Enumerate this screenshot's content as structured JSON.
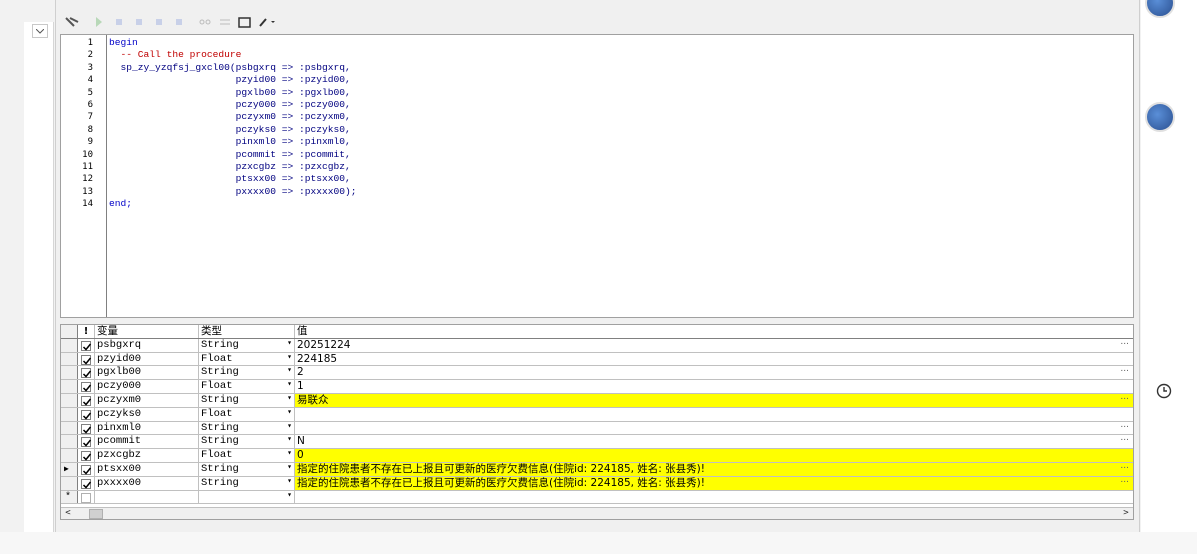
{
  "editor": {
    "line_numbers": [
      "1",
      "2",
      "3",
      "4",
      "5",
      "6",
      "7",
      "8",
      "9",
      "10",
      "11",
      "12",
      "13",
      "14"
    ],
    "lines": [
      {
        "text": "begin",
        "style": "kw"
      },
      {
        "text": "  -- Call the procedure",
        "style": "cm"
      },
      {
        "text": "  sp_zy_yzqfsj_gxcl00(psbgxrq => :psbgxrq,",
        "style": "tx"
      },
      {
        "text": "                      pzyid00 => :pzyid00,",
        "style": "tx"
      },
      {
        "text": "                      pgxlb00 => :pgxlb00,",
        "style": "tx"
      },
      {
        "text": "                      pczy000 => :pczy000,",
        "style": "tx"
      },
      {
        "text": "                      pczyxm0 => :pczyxm0,",
        "style": "tx"
      },
      {
        "text": "                      pczyks0 => :pczyks0,",
        "style": "tx"
      },
      {
        "text": "                      pinxml0 => :pinxml0,",
        "style": "tx"
      },
      {
        "text": "                      pcommit => :pcommit,",
        "style": "tx"
      },
      {
        "text": "                      pzxcgbz => :pzxcgbz,",
        "style": "tx"
      },
      {
        "text": "                      ptsxx00 => :ptsxx00,",
        "style": "tx"
      },
      {
        "text": "                      pxxxx00 => :pxxxx00);",
        "style": "tx"
      },
      {
        "text": "end;",
        "style": "kw"
      }
    ]
  },
  "grid": {
    "headers": {
      "indicator": "!",
      "name": "变量",
      "type": "类型",
      "value": "值"
    },
    "rows": [
      {
        "name": "psbgxrq",
        "type": "String",
        "value": "20251224",
        "highlight": false,
        "ellipsis": true,
        "current": false
      },
      {
        "name": "pzyid00",
        "type": "Float",
        "value": "224185",
        "highlight": false,
        "ellipsis": false,
        "current": false
      },
      {
        "name": "pgxlb00",
        "type": "String",
        "value": "2",
        "highlight": false,
        "ellipsis": true,
        "current": false
      },
      {
        "name": "pczy000",
        "type": "Float",
        "value": "1",
        "highlight": false,
        "ellipsis": false,
        "current": false
      },
      {
        "name": "pczyxm0",
        "type": "String",
        "value": "易联众",
        "highlight": true,
        "ellipsis": true,
        "current": false
      },
      {
        "name": "pczyks0",
        "type": "Float",
        "value": "",
        "highlight": false,
        "ellipsis": false,
        "current": false
      },
      {
        "name": "pinxml0",
        "type": "String",
        "value": "",
        "highlight": false,
        "ellipsis": true,
        "current": false
      },
      {
        "name": "pcommit",
        "type": "String",
        "value": "N",
        "highlight": false,
        "ellipsis": true,
        "current": false
      },
      {
        "name": "pzxcgbz",
        "type": "Float",
        "value": "0",
        "highlight": true,
        "ellipsis": false,
        "current": false
      },
      {
        "name": "ptsxx00",
        "type": "String",
        "value": "指定的住院患者不存在已上报且可更新的医疗欠费信息(住院id: 224185, 姓名: 张县秀)!",
        "highlight": true,
        "ellipsis": true,
        "current": true
      },
      {
        "name": "pxxxx00",
        "type": "String",
        "value": "指定的住院患者不存在已上报且可更新的医疗欠费信息(住院id: 224185, 姓名: 张县秀)!",
        "highlight": true,
        "ellipsis": true,
        "current": false
      }
    ],
    "new_row_marker": "*",
    "row_pointer": "▶"
  },
  "scrollbar": {
    "left_arrow": "<",
    "right_arrow": ">"
  },
  "ellipsis_glyph": "..."
}
